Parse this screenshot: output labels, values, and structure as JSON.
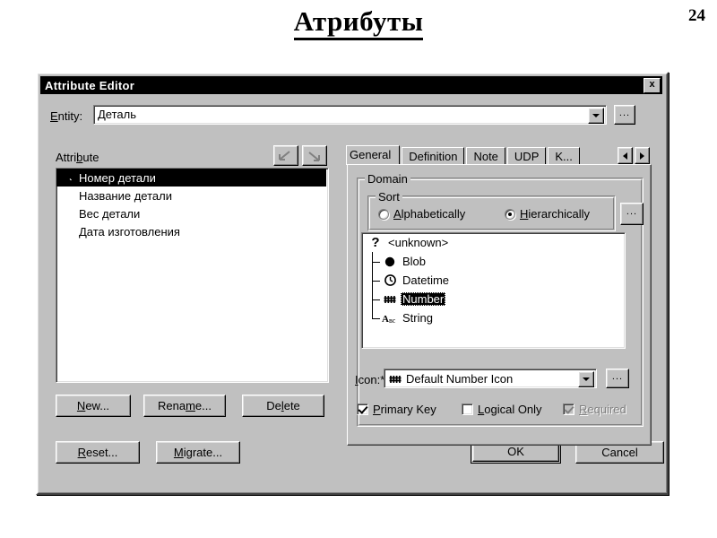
{
  "slide": {
    "title": "Атрибуты",
    "page_number": "24"
  },
  "dialog": {
    "title": "Attribute Editor",
    "close_label": "x",
    "entity": {
      "label": "Entity:",
      "label_acc": "E",
      "value": "Деталь",
      "browse_label": "..."
    },
    "attribute_panel": {
      "label": "Attribute",
      "label_acc": "b",
      "items": [
        {
          "text": "Номер детали",
          "selected": true,
          "has_key_icon": true
        },
        {
          "text": "Название детали",
          "selected": false,
          "has_key_icon": false
        },
        {
          "text": "Вес детали",
          "selected": false,
          "has_key_icon": false
        },
        {
          "text": "Дата изготовления",
          "selected": false,
          "has_key_icon": false
        }
      ],
      "move_up_icon": "move-up-arrow-icon",
      "move_down_icon": "move-down-arrow-icon"
    },
    "list_buttons": [
      {
        "label": "New...",
        "acc": "N"
      },
      {
        "label": "Rename...",
        "acc": "m"
      },
      {
        "label": "Delete",
        "acc": "l"
      }
    ],
    "footer_buttons": [
      {
        "label": "Reset...",
        "acc": "R"
      },
      {
        "label": "Migrate...",
        "acc": "M"
      }
    ],
    "ok_label": "OK",
    "cancel_label": "Cancel",
    "tabs": [
      {
        "label": "General",
        "active": true
      },
      {
        "label": "Definition",
        "active": false
      },
      {
        "label": "Note",
        "active": false
      },
      {
        "label": "UDP",
        "active": false
      },
      {
        "label": "K...",
        "active": false
      }
    ],
    "tab_scroll_left": "scroll-left-icon",
    "tab_scroll_right": "scroll-right-icon",
    "general_tab": {
      "domain_group_title": "Domain",
      "sort_group_title": "Sort",
      "sort_options": [
        {
          "label": "Alphabetically",
          "acc": "A",
          "selected": false
        },
        {
          "label": "Hierarchically",
          "acc": "H",
          "selected": true
        }
      ],
      "sort_browse_label": "...",
      "tree": {
        "root": {
          "label": "<unknown>",
          "icon": "question-mark-icon"
        },
        "children": [
          {
            "label": "Blob",
            "icon": "blob-filled-circle-icon",
            "selected": false
          },
          {
            "label": "Datetime",
            "icon": "clock-icon",
            "selected": false
          },
          {
            "label": "Number",
            "icon": "number-hash-icon",
            "selected": true
          },
          {
            "label": "String",
            "icon": "abc-string-icon",
            "selected": false
          }
        ]
      },
      "icon_field": {
        "label": "Icon:*",
        "label_acc": "I",
        "value": "Default Number Icon",
        "value_icon": "number-hash-icon",
        "browse_label": "..."
      },
      "checkboxes": [
        {
          "label": "Primary Key",
          "acc": "P",
          "checked": true,
          "disabled": false
        },
        {
          "label": "Logical Only",
          "acc": "L",
          "checked": false,
          "disabled": false
        },
        {
          "label": "Required",
          "acc": "R",
          "checked": true,
          "disabled": true
        }
      ]
    }
  },
  "colors": {
    "dialog_face": "#c0c0c0",
    "titlebar": "#000000",
    "field_bg": "#ffffff",
    "selection": "#000000",
    "disabled_text": "#808080"
  }
}
